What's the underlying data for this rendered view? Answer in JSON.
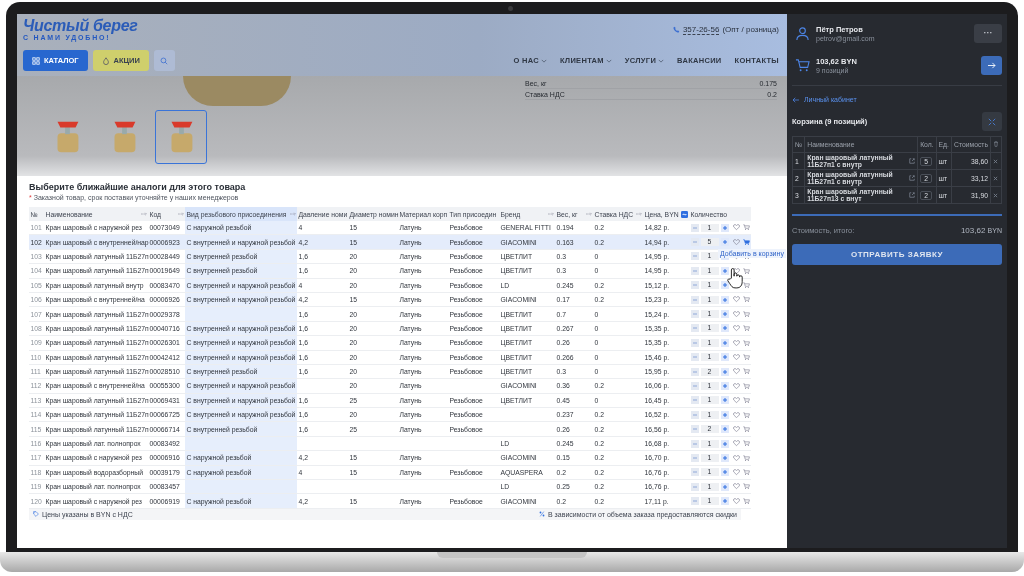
{
  "header": {
    "logo": "Чистый берег",
    "tagline": "С НАМИ УДОБНО!",
    "phone": "357-26-56",
    "phone_note": "(Опт / розница)",
    "buttons": [
      {
        "label": "КАТАЛОГ",
        "kind": "catalog"
      },
      {
        "label": "АКЦИИ",
        "kind": "promo"
      }
    ],
    "nav": [
      {
        "label": "О НАС",
        "dropdown": true
      },
      {
        "label": "КЛИЕНТАМ",
        "dropdown": true
      },
      {
        "label": "УСЛУГИ",
        "dropdown": true
      },
      {
        "label": "ВАКАНСИИ",
        "dropdown": false
      },
      {
        "label": "КОНТАКТЫ",
        "dropdown": false
      }
    ]
  },
  "product": {
    "specs": [
      {
        "label": "Вес, кг",
        "value": "0.175"
      },
      {
        "label": "Ставка НДС",
        "value": "0.2"
      }
    ],
    "thumbnails": [
      {
        "selected": false
      },
      {
        "selected": false
      },
      {
        "selected": true
      }
    ]
  },
  "analogs": {
    "title": "Выберите ближайшие аналоги для этого товара",
    "note_mark": "*",
    "note": "Заказной товар, срок поставки уточняйте у наших менеджеров",
    "columns": [
      {
        "label": "№",
        "highlighted": false
      },
      {
        "label": "Наименование",
        "kind": "sortable",
        "highlighted": false
      },
      {
        "label": "Код",
        "kind": "sortable",
        "highlighted": false
      },
      {
        "label": "Вид резьбового присоединения",
        "kind": "sortable",
        "highlighted": true
      },
      {
        "label": "Давление номи",
        "highlighted": false
      },
      {
        "label": "Диаметр номин",
        "highlighted": false
      },
      {
        "label": "Материал корп",
        "highlighted": false
      },
      {
        "label": "Тип присоедин",
        "highlighted": false
      },
      {
        "label": "Бренд",
        "kind": "sortable",
        "highlighted": false
      },
      {
        "label": "Вес, кг",
        "kind": "sortable",
        "highlighted": false
      },
      {
        "label": "Ставка НДС",
        "kind": "sortable",
        "highlighted": false
      },
      {
        "label": "Цена, BYN",
        "kind": "sorted",
        "highlighted": false
      },
      {
        "label": "Количество",
        "highlighted": false
      }
    ],
    "rows": [
      {
        "no": "101",
        "name": "Кран шаровый с наружной рез",
        "code": "00073049",
        "thread": "С наружной резьбой",
        "pressure": "4",
        "diameter": "15",
        "material": "Латунь",
        "connection": "Резьбовое",
        "brand": "GENERAL FITTI",
        "weight": "0.194",
        "vat": "0.2",
        "price": "14,82 р.",
        "qty": "1",
        "selected": false,
        "in_cart": false
      },
      {
        "no": "102",
        "name": "Кран шаровый с внутренней/нар",
        "code": "00006923",
        "thread": "С внутренней и наружной резьбой",
        "pressure": "4,2",
        "diameter": "15",
        "material": "Латунь",
        "connection": "Резьбовое",
        "brand": "GIACOMINI",
        "weight": "0.163",
        "vat": "0.2",
        "price": "14,94 р.",
        "qty": "5",
        "selected": true,
        "in_cart": true
      },
      {
        "no": "103",
        "name": "Кран шаровый латунный 11Б27п",
        "code": "00028449",
        "thread": "С внутренней резьбой",
        "pressure": "1,6",
        "diameter": "20",
        "material": "Латунь",
        "connection": "Резьбовое",
        "brand": "ЦВЕТЛИТ",
        "weight": "0.3",
        "vat": "0",
        "price": "14,95 р.",
        "qty": "1",
        "selected": false,
        "in_cart": false
      },
      {
        "no": "104",
        "name": "Кран шаровый латунный 11Б27п",
        "code": "00019649",
        "thread": "С внутренней резьбой",
        "pressure": "1,6",
        "diameter": "20",
        "material": "Латунь",
        "connection": "Резьбовое",
        "brand": "ЦВЕТЛИТ",
        "weight": "0.3",
        "vat": "0",
        "price": "14,95 р.",
        "qty": "1",
        "selected": false,
        "in_cart": false
      },
      {
        "no": "105",
        "name": "Кран шаровый латунный внутр",
        "code": "00083470",
        "thread": "С внутренней и наружной резьбой",
        "pressure": "4",
        "diameter": "20",
        "material": "Латунь",
        "connection": "Резьбовое",
        "brand": "LD",
        "weight": "0.245",
        "vat": "0.2",
        "price": "15,12 р.",
        "qty": "1",
        "selected": false,
        "in_cart": false
      },
      {
        "no": "106",
        "name": "Кран шаровый с внутренней/на",
        "code": "00006926",
        "thread": "С внутренней и наружной резьбой",
        "pressure": "4,2",
        "diameter": "15",
        "material": "Латунь",
        "connection": "Резьбовое",
        "brand": "GIACOMINI",
        "weight": "0.17",
        "vat": "0.2",
        "price": "15,23 р.",
        "qty": "1",
        "selected": false,
        "in_cart": false
      },
      {
        "no": "107",
        "name": "Кран шаровый латунный 11Б27п",
        "code": "00029378",
        "pressure": "1,6",
        "diameter": "20",
        "material": "Латунь",
        "connection": "Резьбовое",
        "brand": "ЦВЕТЛИТ",
        "weight": "0.7",
        "vat": "0",
        "price": "15,24 р.",
        "qty": "1",
        "selected": false,
        "in_cart": false
      },
      {
        "no": "108",
        "name": "Кран шаровый латунный 11Б27п",
        "code": "00040716",
        "thread": "С внутренней и наружной резьбой",
        "pressure": "1,6",
        "diameter": "20",
        "material": "Латунь",
        "connection": "Резьбовое",
        "brand": "ЦВЕТЛИТ",
        "weight": "0.267",
        "vat": "0",
        "price": "15,35 р.",
        "qty": "1",
        "selected": false,
        "in_cart": false
      },
      {
        "no": "109",
        "name": "Кран шаровый латунный 11Б27п",
        "code": "00026301",
        "thread": "С внутренней и наружной резьбой",
        "pressure": "1,6",
        "diameter": "20",
        "material": "Латунь",
        "connection": "Резьбовое",
        "brand": "ЦВЕТЛИТ",
        "weight": "0.26",
        "vat": "0",
        "price": "15,35 р.",
        "qty": "1",
        "selected": false,
        "in_cart": false
      },
      {
        "no": "110",
        "name": "Кран шаровый латунный 11Б27п",
        "code": "00042412",
        "thread": "С внутренней и наружной резьбой",
        "pressure": "1,6",
        "diameter": "20",
        "material": "Латунь",
        "connection": "Резьбовое",
        "brand": "ЦВЕТЛИТ",
        "weight": "0.266",
        "vat": "0",
        "price": "15,46 р.",
        "qty": "1",
        "selected": false,
        "in_cart": false
      },
      {
        "no": "111",
        "name": "Кран шаровый латунный 11Б27п",
        "code": "00028510",
        "thread": "С внутренней резьбой",
        "pressure": "1,6",
        "diameter": "20",
        "material": "Латунь",
        "connection": "Резьбовое",
        "brand": "ЦВЕТЛИТ",
        "weight": "0.3",
        "vat": "0",
        "price": "15,95 р.",
        "qty": "2",
        "selected": false,
        "in_cart": false
      },
      {
        "no": "112",
        "name": "Кран шаровый с внутренней/на",
        "code": "00055300",
        "thread": "С внутренней и наружной резьбой",
        "diameter": "20",
        "material": "Латунь",
        "brand": "GIACOMINI",
        "weight": "0.36",
        "vat": "0.2",
        "price": "16,06 р.",
        "qty": "1",
        "selected": false,
        "in_cart": false
      },
      {
        "no": "113",
        "name": "Кран шаровый латунный 11Б27п",
        "code": "00069431",
        "thread": "С внутренней и наружной резьбой",
        "pressure": "1,6",
        "diameter": "25",
        "material": "Латунь",
        "connection": "Резьбовое",
        "brand": "ЦВЕТЛИТ",
        "weight": "0.45",
        "vat": "0",
        "price": "16,45 р.",
        "qty": "1",
        "selected": false,
        "in_cart": false
      },
      {
        "no": "114",
        "name": "Кран шаровый латунный 11Б27п",
        "code": "00066725",
        "thread": "С внутренней и наружной резьбой",
        "pressure": "1,6",
        "diameter": "20",
        "material": "Латунь",
        "connection": "Резьбовое",
        "weight": "0.237",
        "vat": "0.2",
        "price": "16,52 р.",
        "qty": "1",
        "selected": false,
        "in_cart": false
      },
      {
        "no": "115",
        "name": "Кран шаровый латунный 11Б27п",
        "code": "00066714",
        "thread": "С внутренней резьбой",
        "pressure": "1,6",
        "diameter": "25",
        "material": "Латунь",
        "connection": "Резьбовое",
        "weight": "0.26",
        "vat": "0.2",
        "price": "16,56 р.",
        "qty": "2",
        "selected": false,
        "in_cart": false
      },
      {
        "no": "116",
        "name": "Кран шаровый лат. полнопрох",
        "code": "00083492",
        "brand": "LD",
        "weight": "0.245",
        "vat": "0.2",
        "price": "16,68 р.",
        "qty": "1",
        "selected": false,
        "in_cart": false
      },
      {
        "no": "117",
        "name": "Кран шаровый с наружной рез",
        "code": "00006916",
        "thread": "С наружной резьбой",
        "pressure": "4,2",
        "diameter": "15",
        "material": "Латунь",
        "brand": "GIACOMINI",
        "weight": "0.15",
        "vat": "0.2",
        "price": "16,70 р.",
        "qty": "1",
        "selected": false,
        "in_cart": false
      },
      {
        "no": "118",
        "name": "Кран шаровый водоразборный",
        "code": "00039179",
        "thread": "С наружной резьбой",
        "pressure": "4",
        "diameter": "15",
        "material": "Латунь",
        "connection": "Резьбовое",
        "brand": "AQUASPERA",
        "weight": "0.2",
        "vat": "0.2",
        "price": "16,76 р.",
        "qty": "1",
        "selected": false,
        "in_cart": false
      },
      {
        "no": "119",
        "name": "Кран шаровый лат. полнопрох",
        "code": "00083457",
        "brand": "LD",
        "weight": "0.25",
        "vat": "0.2",
        "price": "16,76 р.",
        "qty": "1",
        "selected": false,
        "in_cart": false
      },
      {
        "no": "120",
        "name": "Кран шаровый с наружной рез",
        "code": "00006919",
        "thread": "С наружной резьбой",
        "pressure": "4,2",
        "diameter": "15",
        "material": "Латунь",
        "connection": "Резьбовое",
        "brand": "GIACOMINI",
        "weight": "0.2",
        "vat": "0.2",
        "price": "17,11 р.",
        "qty": "1",
        "selected": false,
        "in_cart": false
      }
    ],
    "footer_left": "Цены указаны в BYN с НДС",
    "footer_right": "В зависимости от объема заказа предоставляются скидки",
    "tooltip": "Добавить в корзину"
  },
  "sidebar": {
    "user_name": "Пётр Петров",
    "user_email": "petrov@gmail.com",
    "more_button": "···",
    "cart_total": "103,62 BYN",
    "cart_count": "9 позиций",
    "back_link": "Личный кабинет",
    "cart_title": "Корзина (9 позиций)",
    "cart_columns": [
      "№",
      "Наименование",
      "Кол.",
      "Ед.",
      "Стоимость"
    ],
    "cart_rows": [
      {
        "no": "1",
        "name": "Кран шаровый латунный 11Б27п1 с внутр",
        "qty": "5",
        "unit": "шт",
        "cost": "38,60"
      },
      {
        "no": "2",
        "name": "Кран шаровый латунный 11Б27п1 с внутр",
        "qty": "2",
        "unit": "шт",
        "cost": "33,12"
      },
      {
        "no": "3",
        "name": "Кран шаровый латунный 11Б27п13 с внут",
        "qty": "2",
        "unit": "шт",
        "cost": "31,90"
      }
    ],
    "total_label": "Стоимость, итого:",
    "total_value": "103,62",
    "total_currency": "BYN",
    "submit": "ОТПРАВИТЬ ЗАЯВКУ"
  }
}
